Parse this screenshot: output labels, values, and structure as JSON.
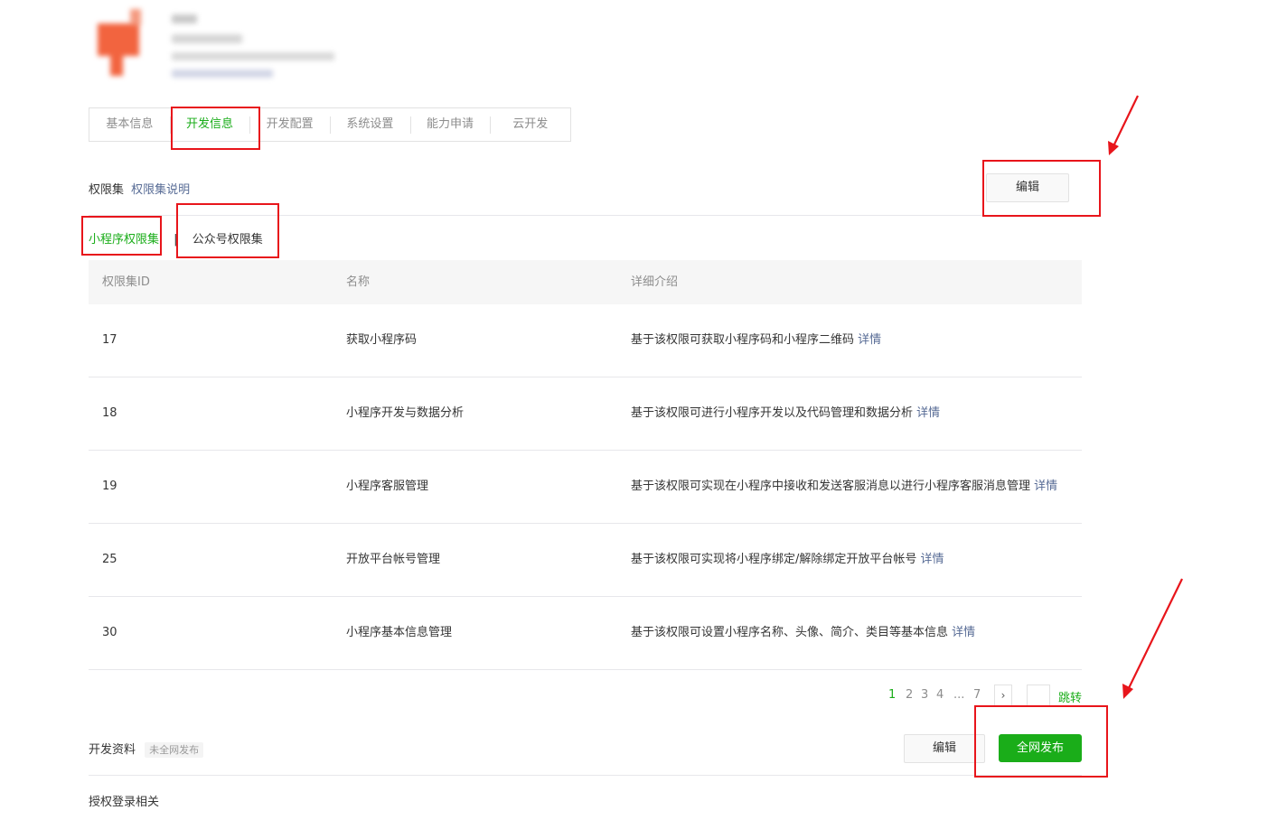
{
  "tabs": [
    {
      "label": "基本信息",
      "active": false
    },
    {
      "label": "开发信息",
      "active": true
    },
    {
      "label": "开发配置",
      "active": false
    },
    {
      "label": "系统设置",
      "active": false
    },
    {
      "label": "能力申请",
      "active": false
    },
    {
      "label": "云开发",
      "active": false
    }
  ],
  "permission_section": {
    "title": "权限集",
    "help_link": "权限集说明",
    "edit_label": "编辑"
  },
  "subtabs": {
    "miniprogram": "小程序权限集",
    "separator": "|",
    "official_account": "公众号权限集"
  },
  "table": {
    "headers": [
      "权限集ID",
      "名称",
      "详细介绍"
    ],
    "detail_link": "详情",
    "rows": [
      {
        "id": "17",
        "name": "获取小程序码",
        "desc": "基于该权限可获取小程序码和小程序二维码"
      },
      {
        "id": "18",
        "name": "小程序开发与数据分析",
        "desc": "基于该权限可进行小程序开发以及代码管理和数据分析"
      },
      {
        "id": "19",
        "name": "小程序客服管理",
        "desc": "基于该权限可实现在小程序中接收和发送客服消息以进行小程序客服消息管理"
      },
      {
        "id": "25",
        "name": "开放平台帐号管理",
        "desc": "基于该权限可实现将小程序绑定/解除绑定开放平台帐号"
      },
      {
        "id": "30",
        "name": "小程序基本信息管理",
        "desc": "基于该权限可设置小程序名称、头像、简介、类目等基本信息"
      }
    ]
  },
  "pagination": {
    "pages": [
      "1",
      "2",
      "3",
      "4",
      "...",
      "7"
    ],
    "current": "1",
    "next": "›",
    "jump_label": "跳转"
  },
  "dev_section": {
    "title": "开发资料",
    "badge": "未全网发布",
    "edit_label": "编辑",
    "publish_label": "全网发布"
  },
  "auth_section": {
    "title": "授权登录相关"
  },
  "colors": {
    "accent": "#1aad19",
    "link": "#576b95",
    "annotation": "#e8151b"
  }
}
